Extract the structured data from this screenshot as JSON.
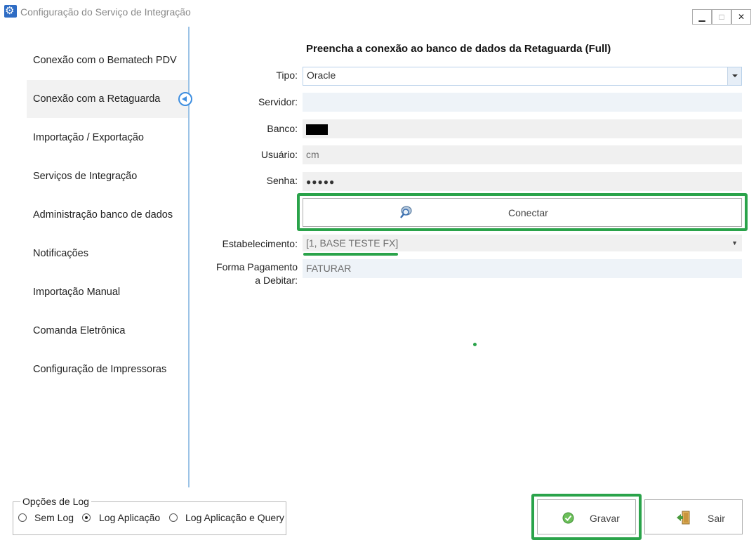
{
  "window": {
    "title": "Configuração do Serviço de Integração",
    "minimize_glyph": "▁",
    "maximize_glyph": "□",
    "close_glyph": "✕"
  },
  "sidebar": {
    "items": [
      {
        "label": "Conexão com o Bematech PDV"
      },
      {
        "label": "Conexão com a Retaguarda"
      },
      {
        "label": "Importação / Exportação"
      },
      {
        "label": "Serviços de Integração"
      },
      {
        "label": "Administração banco de dados"
      },
      {
        "label": "Notificações"
      },
      {
        "label": "Importação Manual"
      },
      {
        "label": "Comanda Eletrônica"
      },
      {
        "label": "Configuração de Impressoras"
      }
    ],
    "active_index": 1
  },
  "form": {
    "heading": "Preencha a conexão ao banco de dados da Retaguarda (Full)",
    "tipo_label": "Tipo:",
    "tipo_value": "Oracle",
    "servidor_label": "Servidor:",
    "servidor_value": "",
    "banco_label": "Banco:",
    "usuario_label": "Usuário:",
    "usuario_value": "cm",
    "senha_label": "Senha:",
    "senha_value": "●●●●●",
    "conectar_label": "Conectar",
    "estabelecimento_label": "Estabelecimento:",
    "estabelecimento_value": "[1, BASE TESTE FX]",
    "forma_pagamento_label_1": "Forma Pagamento",
    "forma_pagamento_label_2": "a Debitar:",
    "forma_pagamento_value": "FATURAR"
  },
  "log_options": {
    "title": "Opções de Log",
    "options": [
      {
        "label": "Sem Log",
        "checked": false
      },
      {
        "label": "Log Aplicação",
        "checked": true
      },
      {
        "label": "Log Aplicação e Query",
        "checked": false
      }
    ]
  },
  "actions": {
    "gravar_label": "Gravar",
    "sair_label": "Sair"
  },
  "colors": {
    "highlight": "#2aa34a",
    "accent": "#3d8ee0"
  }
}
